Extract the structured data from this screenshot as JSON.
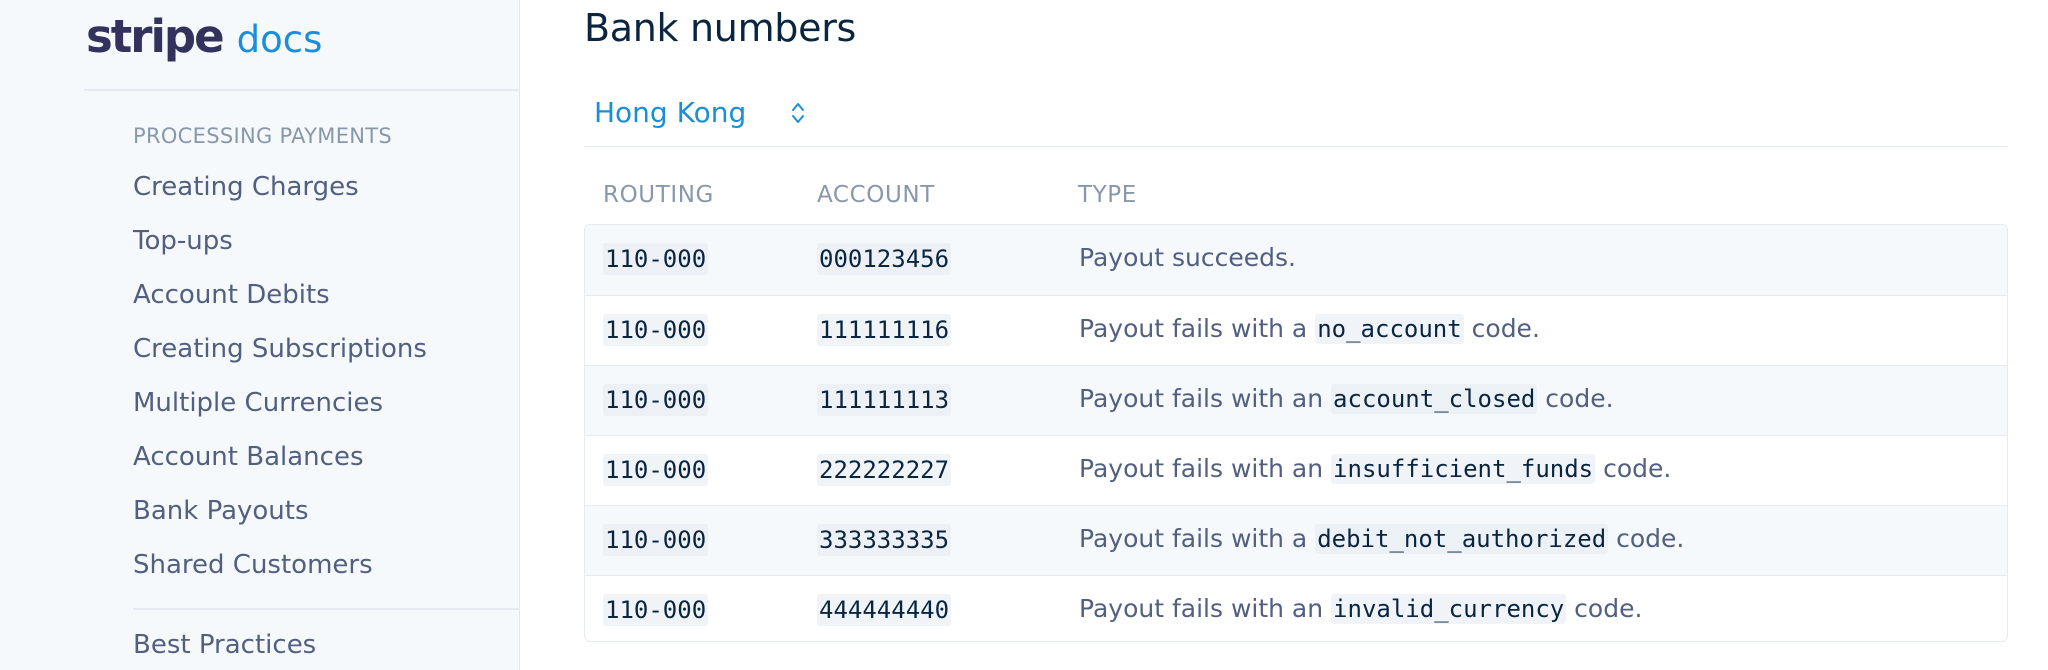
{
  "brand": {
    "name": "stripe",
    "product": "docs",
    "accent": "#1a8fd8",
    "text": "#32325d"
  },
  "sidebar": {
    "section_heading": "PROCESSING PAYMENTS",
    "items": [
      {
        "label": "Creating Charges"
      },
      {
        "label": "Top-ups"
      },
      {
        "label": "Account Debits"
      },
      {
        "label": "Creating Subscriptions"
      },
      {
        "label": "Multiple Currencies"
      },
      {
        "label": "Account Balances"
      },
      {
        "label": "Bank Payouts"
      },
      {
        "label": "Shared Customers"
      }
    ],
    "extra_item": "Best Practices"
  },
  "main": {
    "title": "Bank numbers",
    "country_select": {
      "value": "Hong Kong",
      "icon": "updown-chevron-icon"
    },
    "table": {
      "headers": {
        "routing": "ROUTING",
        "account": "ACCOUNT",
        "type": "TYPE"
      },
      "rows": [
        {
          "routing": "110-000",
          "account": "000123456",
          "type_prefix": "Payout succeeds.",
          "code": "",
          "type_suffix": ""
        },
        {
          "routing": "110-000",
          "account": "111111116",
          "type_prefix": "Payout fails with a ",
          "code": "no_account",
          "type_suffix": " code."
        },
        {
          "routing": "110-000",
          "account": "111111113",
          "type_prefix": "Payout fails with an ",
          "code": "account_closed",
          "type_suffix": " code."
        },
        {
          "routing": "110-000",
          "account": "222222227",
          "type_prefix": "Payout fails with an ",
          "code": "insufficient_funds",
          "type_suffix": " code."
        },
        {
          "routing": "110-000",
          "account": "333333335",
          "type_prefix": "Payout fails with a ",
          "code": "debit_not_authorized",
          "type_suffix": " code."
        },
        {
          "routing": "110-000",
          "account": "444444440",
          "type_prefix": "Payout fails with an ",
          "code": "invalid_currency",
          "type_suffix": " code."
        }
      ]
    }
  }
}
